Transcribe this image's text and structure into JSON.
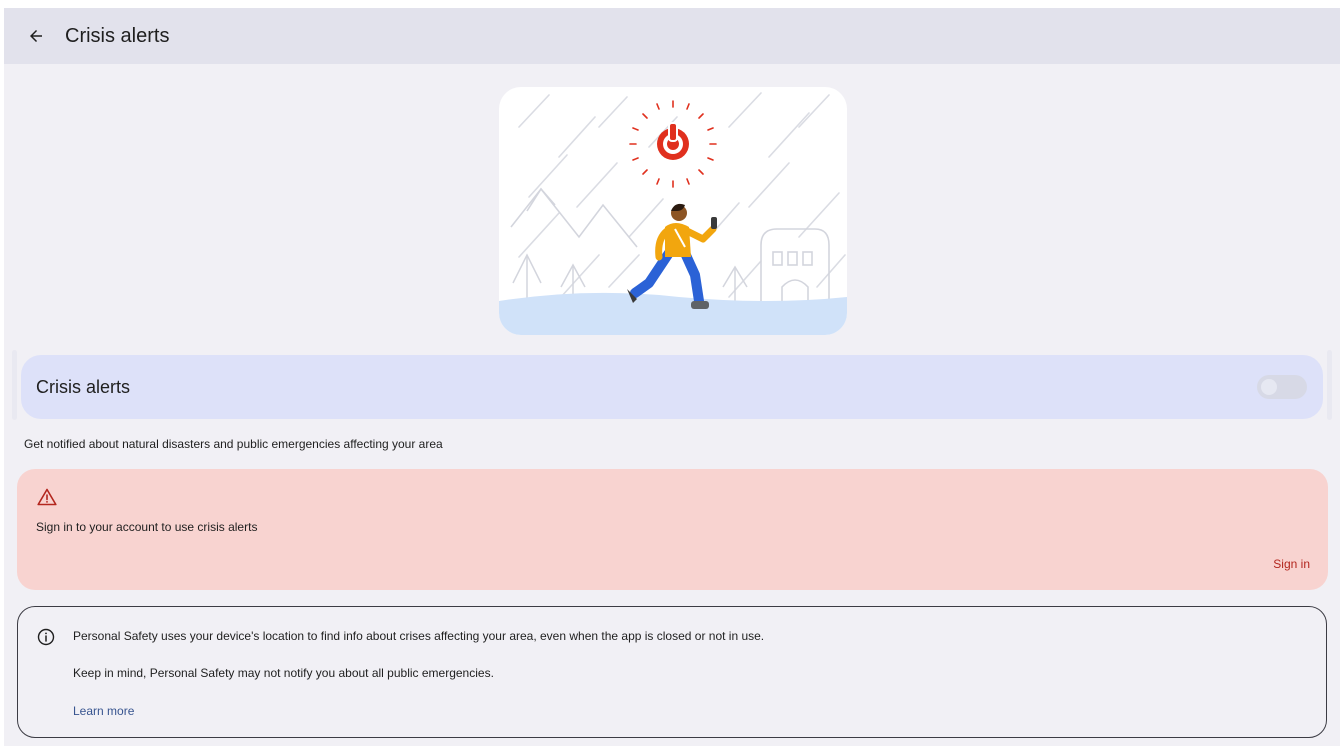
{
  "app_bar": {
    "title": "Crisis alerts",
    "back_icon": "arrow-back-icon"
  },
  "hero": {
    "illustration": "person-running-from-storm-illustration",
    "alert_icon": "emergency-alert-icon"
  },
  "toggle": {
    "label": "Crisis alerts",
    "state": "off"
  },
  "description": "Get notified about natural disasters and public emergencies affecting your area",
  "warning": {
    "icon": "warning-icon",
    "message": "Sign in to your account to use crisis alerts",
    "action_label": "Sign in"
  },
  "info": {
    "icon": "info-icon",
    "line1": "Personal Safety uses your device's location to find info about crises affecting your area, even when the app is closed or not in use.",
    "line2": "Keep in mind, Personal Safety may not notify you about all public emergencies.",
    "link_label": "Learn more"
  },
  "colors": {
    "background": "#f1f0f5",
    "app_bar": "#e2e2ec",
    "toggle_row": "#dde1f9",
    "warning_card": "#f8d3d0",
    "warning_accent": "#b3261e",
    "link": "#37548f",
    "alert_red": "#e0301e"
  }
}
